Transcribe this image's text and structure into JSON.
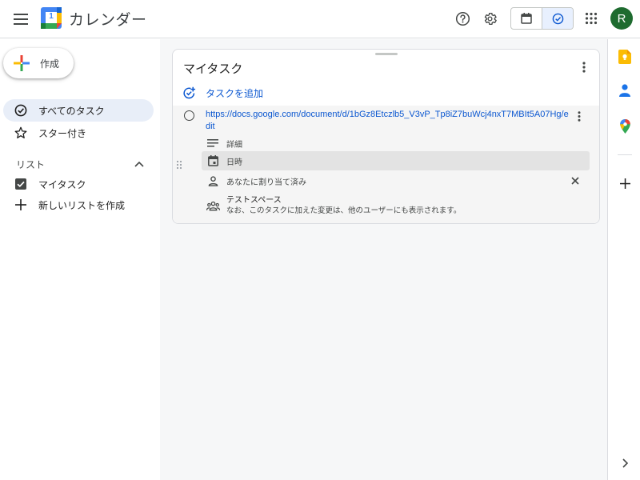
{
  "header": {
    "app_title": "カレンダー",
    "logo_day": "1",
    "avatar_letter": "R",
    "icons": [
      "menu-icon",
      "help-icon",
      "settings-icon",
      "calendar-view-icon",
      "tasks-view-icon",
      "apps-grid-icon"
    ]
  },
  "sidebar": {
    "create_label": "作成",
    "nav": [
      {
        "label": "すべてのタスク",
        "icon": "task-check-icon",
        "active": true
      },
      {
        "label": "スター付き",
        "icon": "star-icon",
        "active": false
      }
    ],
    "lists_header": "リスト",
    "lists": [
      {
        "label": "マイタスク",
        "icon": "checkbox-checked-icon"
      },
      {
        "label": "新しいリストを作成",
        "icon": "plus-icon"
      }
    ]
  },
  "main": {
    "card_title": "マイタスク",
    "add_task_label": "タスクを追加",
    "task": {
      "title_link": "https://docs.google.com/document/d/1bGz8Etczlb5_V3vP_Tp8iZ7buWcj4nxT7MBIt5A07Hg/edit",
      "details_label": "詳細",
      "date_label": "日時",
      "assignee_label": "あなたに割り当て済み",
      "space_name": "テストスペース",
      "space_note": "なお、このタスクに加えた変更は、他のユーザーにも表示されます。"
    }
  },
  "right_rail": {
    "icons": [
      "keep-icon",
      "contacts-icon",
      "maps-icon",
      "add-addon-icon",
      "expand-panel-icon"
    ]
  },
  "colors": {
    "accent": "#0b57d0",
    "active_nav_bg": "#e8eef8",
    "avatar_bg": "#1e6b2f"
  }
}
